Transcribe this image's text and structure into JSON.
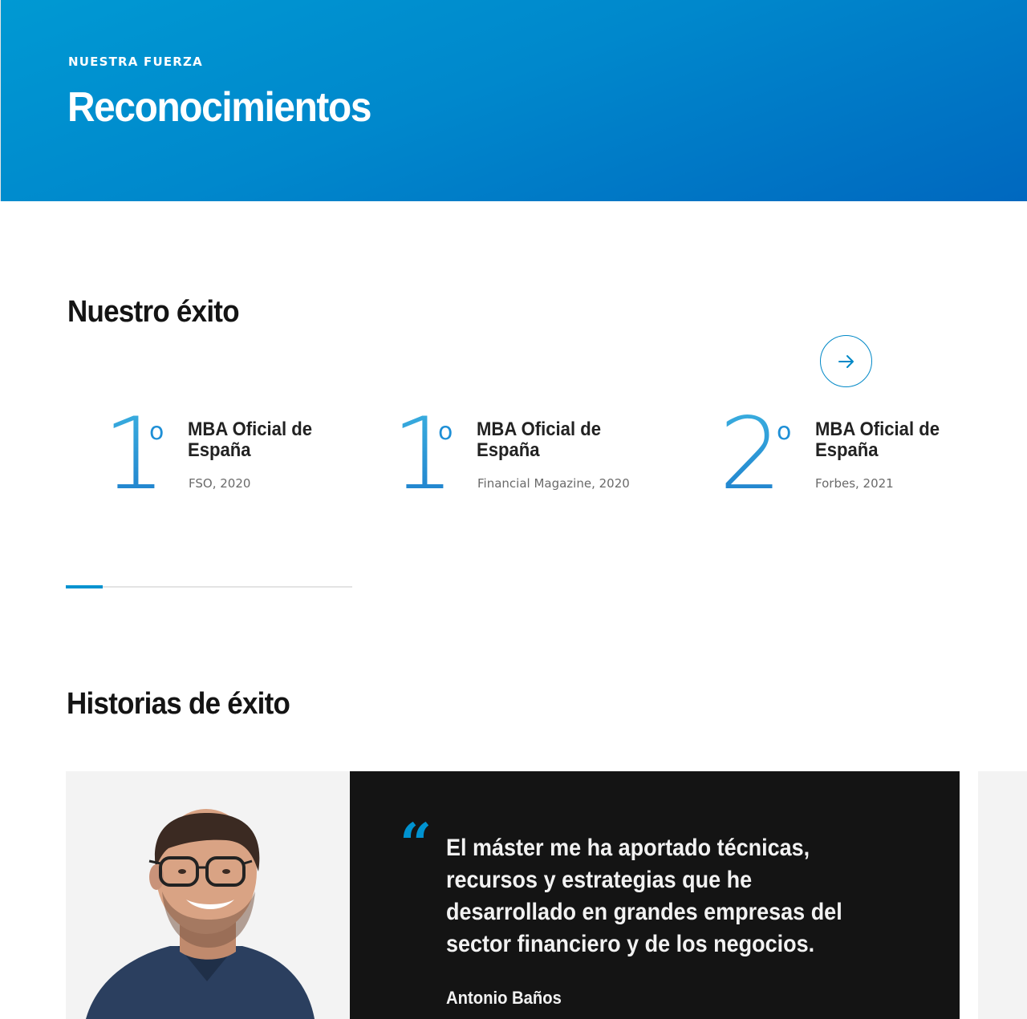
{
  "hero": {
    "eyebrow": "NUESTRA FUERZA",
    "title": "Reconocimientos"
  },
  "success": {
    "title": "Nuestro éxito",
    "next_icon": "arrow-right-icon",
    "progress_fraction": 0.13,
    "awards": [
      {
        "rank": "1",
        "ordinal": "o",
        "title": "MBA Oficial de España",
        "source": "FSO, 2020"
      },
      {
        "rank": "1",
        "ordinal": "o",
        "title": "MBA Oficial de España",
        "source": "Financial Magazine, 2020"
      },
      {
        "rank": "2",
        "ordinal": "o",
        "title": "MBA Oficial de España",
        "source": "Forbes, 2021"
      }
    ]
  },
  "stories": {
    "title": "Historias de éxito",
    "quote_icon": "quote-icon",
    "quote": "El máster me ha aportado técnicas, recursos y estrategias que he desarrollado en grandes empresas del sector financiero y de los negocios.",
    "author": "Antonio Baños"
  },
  "colors": {
    "accent": "#0092d0",
    "hero_start": "#0099d3",
    "hero_end": "#0068bf",
    "dark_panel": "#141414"
  }
}
